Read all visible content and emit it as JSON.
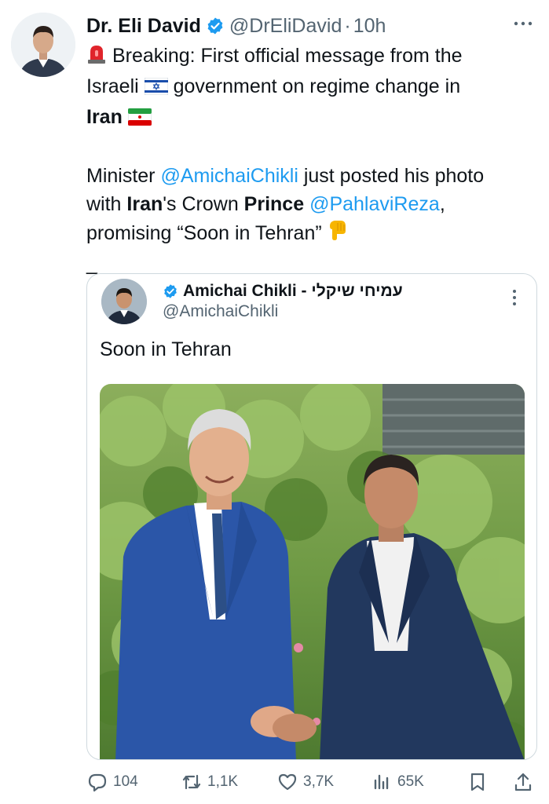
{
  "tweet": {
    "display_name": "Dr. Eli David",
    "handle": "@DrEliDavid",
    "separator": "·",
    "time": "10h",
    "more_icon": "more-horizontal-icon",
    "text": {
      "line1_emoji": "🚨",
      "line1": "Breaking: First official message from the",
      "line2_a": "Israeli",
      "line2_flag": "israel-flag",
      "line2_b": "government on regime change in",
      "line3_bold": "Iran",
      "line3_flag": "iran-flag",
      "para2_a": "Minister ",
      "para2_mention1": "@AmichaiChikli",
      "para2_b": " just posted his photo",
      "para2_c": "with ",
      "para2_bold1": "Iran",
      "para2_d": "'s Crown ",
      "para2_bold2": "Prince",
      "para2_e": " ",
      "para2_mention2": "@PahlaviReza",
      "para2_f": ",",
      "para2_g": "promising “Soon in Tehran”",
      "para2_emoji": "pointing-down-hand",
      "trailer": "_"
    }
  },
  "quote": {
    "display_name": "Amichai Chikli - עמיחי שיקלי",
    "handle": "@AmichaiChikli",
    "text": "Soon in Tehran",
    "more_icon": "more-vertical-icon"
  },
  "actions": {
    "replies": "104",
    "retweets": "1,1K",
    "likes": "3,7K",
    "views": "65K"
  },
  "colors": {
    "accent": "#1d9bf0",
    "text": "#0f1419",
    "muted": "#536471",
    "border": "#cfd9de"
  }
}
